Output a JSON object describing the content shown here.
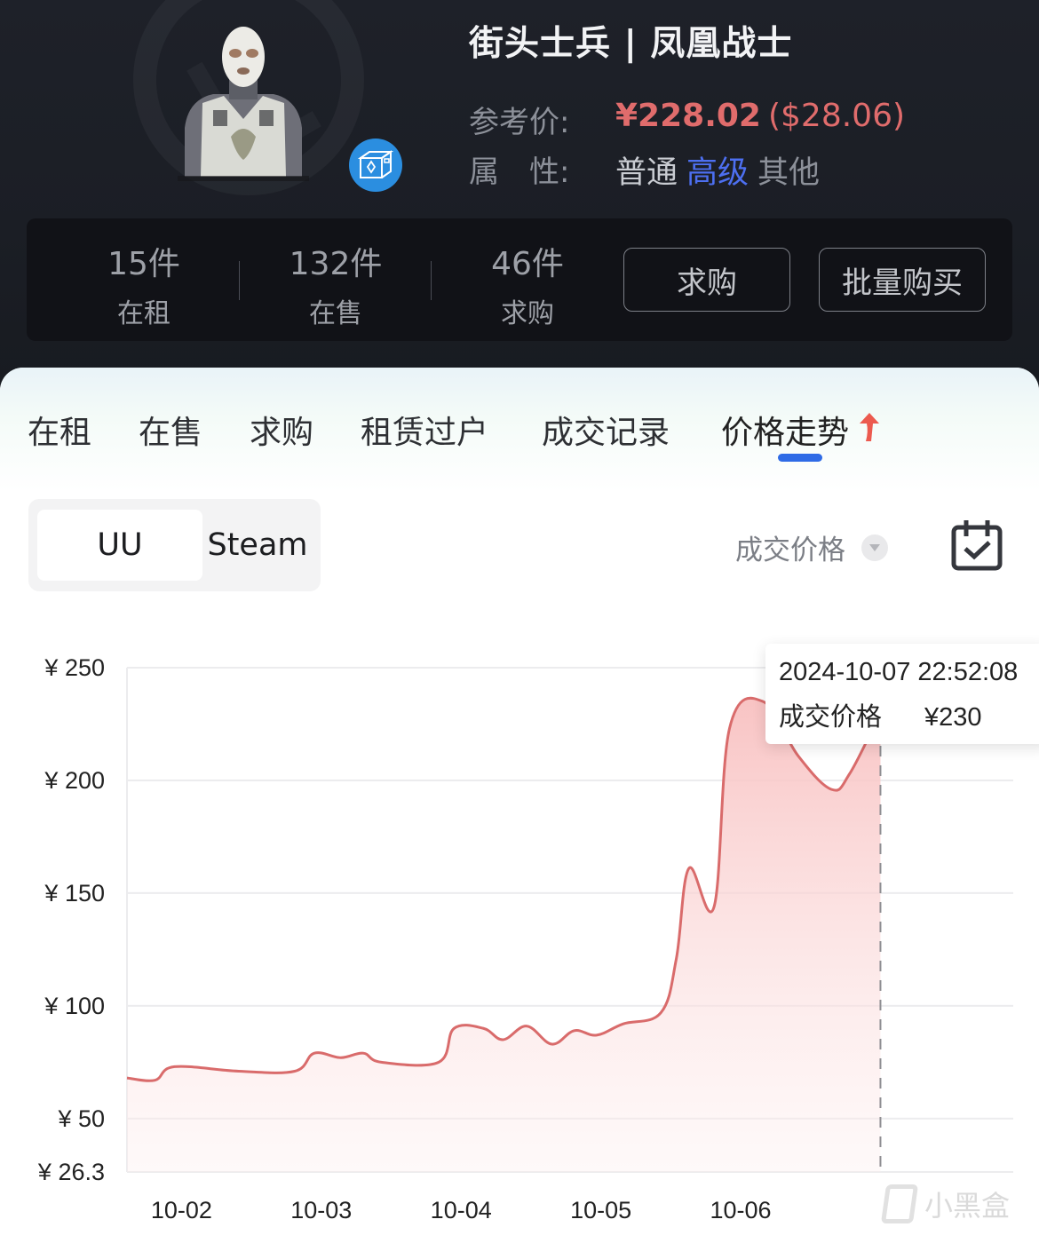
{
  "item": {
    "title": "街头士兵 | 凤凰战士",
    "ref_price_label": "参考价:",
    "ref_price_cny": "¥228.02",
    "ref_price_usd": "($28.06)",
    "attr_label": "属　性:",
    "attrs": [
      {
        "label": "普通",
        "state": "normal"
      },
      {
        "label": "高级",
        "state": "highlight"
      },
      {
        "label": "其他",
        "state": "dim"
      }
    ],
    "badge_icon": "box-icon"
  },
  "stats": [
    {
      "count": "15件",
      "label": "在租"
    },
    {
      "count": "132件",
      "label": "在售"
    },
    {
      "count": "46件",
      "label": "求购"
    }
  ],
  "actions": {
    "buy_request": "求购",
    "bulk_buy": "批量购买"
  },
  "tabs": [
    {
      "label": "在租",
      "active": false
    },
    {
      "label": "在售",
      "active": false
    },
    {
      "label": "求购",
      "active": false
    },
    {
      "label": "租赁过户",
      "active": false
    },
    {
      "label": "成交记录",
      "active": false
    },
    {
      "label": "价格走势",
      "active": true,
      "icon": "trend-up-arrow-icon"
    }
  ],
  "source_toggle": {
    "options": [
      "UU",
      "Steam"
    ],
    "selected": "UU"
  },
  "metric_select": {
    "value": "成交价格",
    "icon": "caret-down-icon"
  },
  "calendar_icon": "calendar-check-icon",
  "colors": {
    "line": "#d96b6b",
    "fill": "#f8c9c9",
    "price_red": "#e06c6c",
    "highlight_blue": "#4d6ff0",
    "tab_indicator": "#2f6be6",
    "badge_blue": "#2b8ee0"
  },
  "tooltip": {
    "time": "2024-10-07 22:52:08",
    "label": "成交价格",
    "value": "¥230"
  },
  "watermark": "小黑盒",
  "chart_data": {
    "type": "area",
    "title": "",
    "xlabel": "",
    "ylabel": "",
    "currency": "¥",
    "x_unit": "days since 10-01 00:00",
    "xlim": [
      0.61,
      6.95
    ],
    "ylim": [
      26.3,
      250
    ],
    "y_ticks": [
      {
        "value": 250,
        "label": "¥250"
      },
      {
        "value": 200,
        "label": "¥200"
      },
      {
        "value": 150,
        "label": "¥150"
      },
      {
        "value": 100,
        "label": "¥100"
      },
      {
        "value": 50,
        "label": "¥50"
      },
      {
        "value": 26.3,
        "label": "¥26.3"
      }
    ],
    "x_ticks": [
      {
        "value": 1,
        "label": "10-02"
      },
      {
        "value": 2,
        "label": "10-03"
      },
      {
        "value": 3,
        "label": "10-04"
      },
      {
        "value": 4,
        "label": "10-05"
      },
      {
        "value": 5,
        "label": "10-06"
      }
    ],
    "grid": true,
    "smooth": true,
    "series": [
      {
        "name": "成交价格",
        "points": [
          [
            0.61,
            68
          ],
          [
            0.81,
            67
          ],
          [
            0.95,
            73
          ],
          [
            1.41,
            71
          ],
          [
            1.81,
            71
          ],
          [
            1.95,
            79
          ],
          [
            2.14,
            77
          ],
          [
            2.3,
            79
          ],
          [
            2.43,
            75
          ],
          [
            2.84,
            75
          ],
          [
            2.95,
            90
          ],
          [
            3.16,
            90
          ],
          [
            3.3,
            85
          ],
          [
            3.47,
            91
          ],
          [
            3.65,
            83
          ],
          [
            3.81,
            89
          ],
          [
            3.97,
            87
          ],
          [
            4.16,
            92
          ],
          [
            4.43,
            97
          ],
          [
            4.54,
            121
          ],
          [
            4.63,
            161
          ],
          [
            4.81,
            144
          ],
          [
            4.92,
            223
          ],
          [
            5.16,
            235
          ],
          [
            5.41,
            211
          ],
          [
            5.65,
            196
          ],
          [
            5.78,
            203
          ],
          [
            6.0,
            230
          ]
        ]
      }
    ],
    "hover_marker": {
      "x": 6.0,
      "style": "dashed-vertical"
    }
  }
}
